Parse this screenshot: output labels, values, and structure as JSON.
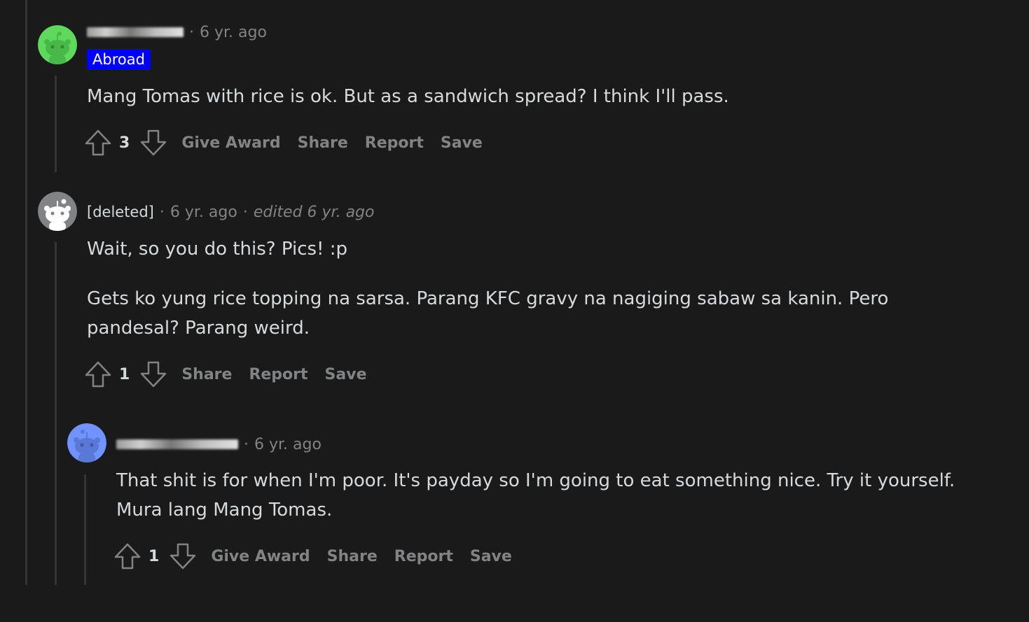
{
  "comments": [
    {
      "author_label": "",
      "timestamp": "6 yr. ago",
      "flair": "Abroad",
      "body": [
        "Mang Tomas with rice is ok. But as a sandwich spread? I think I'll pass."
      ],
      "votes": "3",
      "actions": [
        "Give Award",
        "Share",
        "Report",
        "Save"
      ],
      "avatar_color": "#5ed95e"
    },
    {
      "author_label": "[deleted]",
      "timestamp": "6 yr. ago",
      "edited": "edited 6 yr. ago",
      "body": [
        "Wait, so you do this? Pics! :p",
        "Gets ko yung rice topping na sarsa. Parang KFC gravy na nagiging sabaw sa kanin. Pero pandesal? Parang weird."
      ],
      "votes": "1",
      "actions": [
        "Share",
        "Report",
        "Save"
      ],
      "avatar_color": "#818384"
    },
    {
      "author_label": "",
      "timestamp": "6 yr. ago",
      "body": [
        "That shit is for when I'm poor. It's payday so I'm going to eat something nice. Try it yourself. Mura lang Mang Tomas."
      ],
      "votes": "1",
      "actions": [
        "Give Award",
        "Share",
        "Report",
        "Save"
      ],
      "avatar_color": "#7193ff"
    }
  ],
  "icons": {
    "upvote": "arrow-up-icon",
    "downvote": "arrow-down-icon",
    "avatar": "snoo-avatar-icon"
  }
}
